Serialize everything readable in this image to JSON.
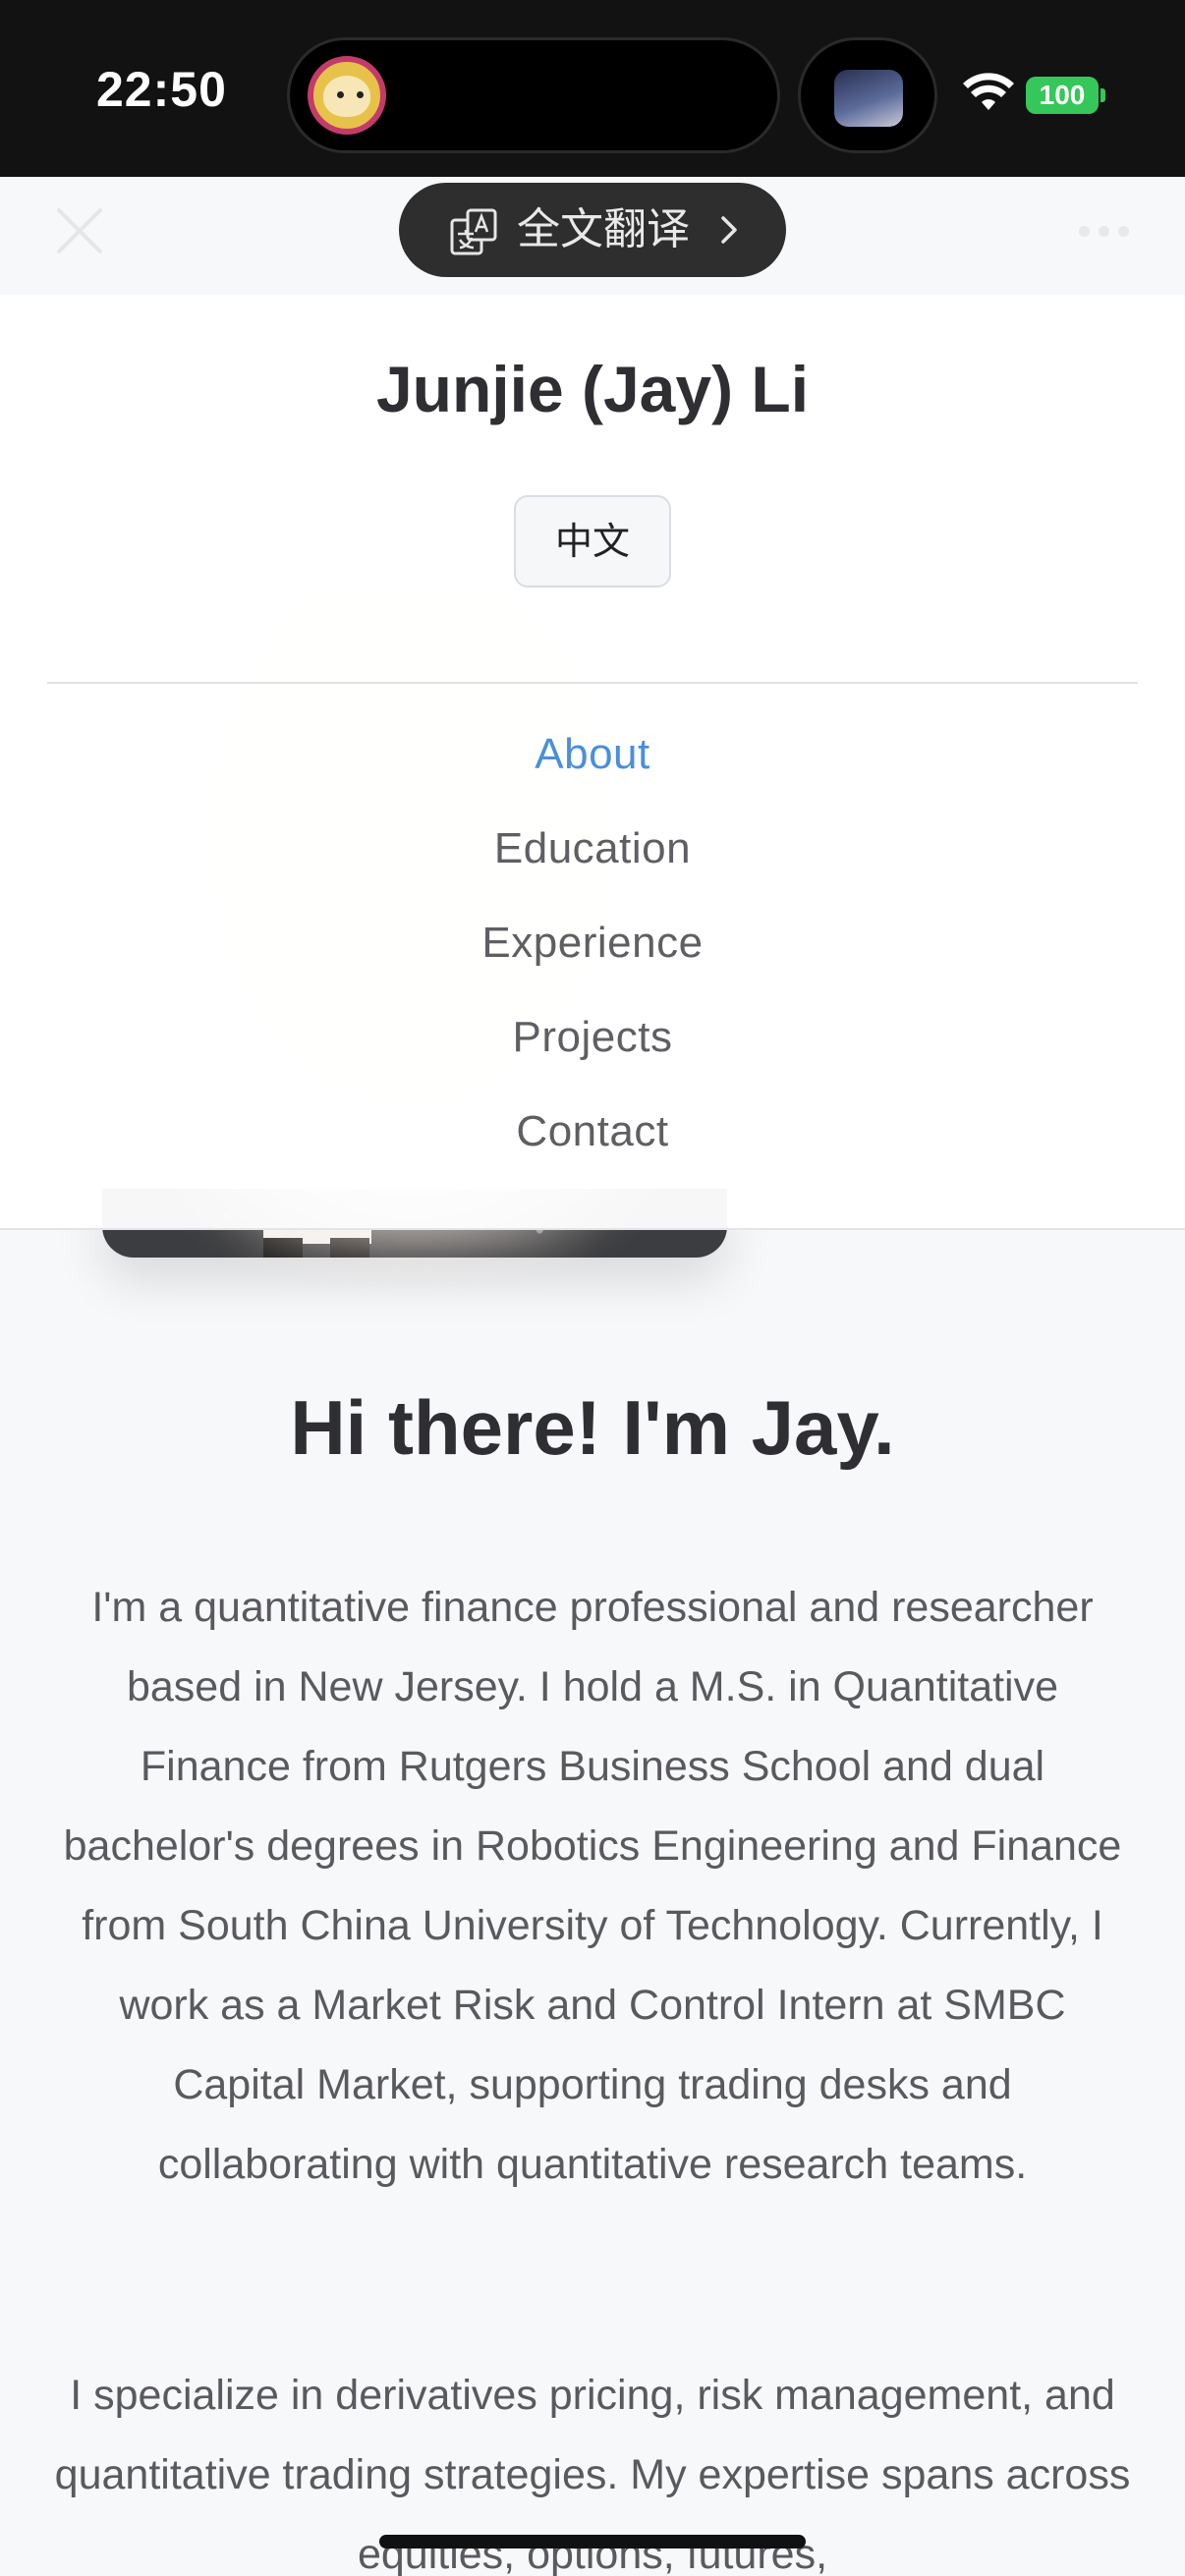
{
  "status_bar": {
    "time": "22:50",
    "battery": "100",
    "wifi_icon": "wifi-icon"
  },
  "browser_bar": {
    "close_icon": "close-icon",
    "translate_label": "全文翻译",
    "translate_icon": "translate-icon",
    "more_icon": "more-icon"
  },
  "header": {
    "title": "Junjie (Jay) Li",
    "lang_button": "中文",
    "nav": [
      {
        "label": "About",
        "active": true
      },
      {
        "label": "Education",
        "active": false
      },
      {
        "label": "Experience",
        "active": false
      },
      {
        "label": "Projects",
        "active": false
      },
      {
        "label": "Contact",
        "active": false
      }
    ],
    "active_color": "#4a8fdb"
  },
  "main": {
    "greeting": "Hi there! I'm Jay.",
    "paragraph1": "I'm a quantitative finance professional and researcher based in New Jersey. I hold a M.S. in Quantitative Finance from Rutgers Business School and dual bachelor's degrees in Robotics Engineering and Finance from South China University of Technology. Currently, I work as a Market Risk and Control Intern at SMBC Capital Market, supporting trading desks and collaborating with quantitative research teams.",
    "paragraph2": "I specialize in derivatives pricing, risk management, and quantitative trading strategies. My expertise spans across equities, options, futures,"
  }
}
